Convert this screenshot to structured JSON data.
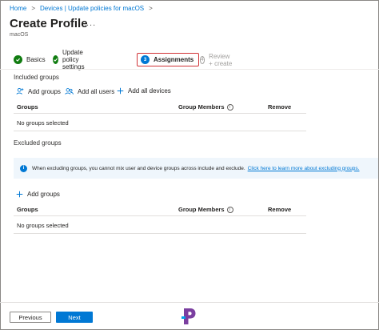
{
  "breadcrumb": {
    "home": "Home",
    "separator": ">",
    "devices": "Devices | Update policies for macOS"
  },
  "header": {
    "title": "Create Profile",
    "subtitle": "macOS",
    "more": "..."
  },
  "steps": [
    {
      "label": "Basics",
      "state": "done",
      "icon": "check-icon"
    },
    {
      "label": "Update policy settings",
      "state": "done",
      "icon": "check-icon"
    },
    {
      "label": "Assignments",
      "number": "3",
      "state": "current"
    },
    {
      "label": "Review + create",
      "number": "4",
      "state": "future"
    }
  ],
  "included": {
    "title": "Included groups",
    "commands": {
      "add_groups": "Add groups",
      "add_all_users": "Add all users",
      "add_all_devices": "Add all devices"
    },
    "table": {
      "columns": [
        "Groups",
        "Group Members",
        "Remove"
      ],
      "empty": "No groups selected"
    }
  },
  "excluded": {
    "title": "Excluded groups",
    "banner": {
      "text": "When excluding groups, you cannot mix user and device groups across include and exclude.",
      "link": "Click here to learn more about excluding groups."
    },
    "commands": {
      "add_groups": "Add groups"
    },
    "table": {
      "columns": [
        "Groups",
        "Group Members",
        "Remove"
      ],
      "empty": "No groups selected"
    }
  },
  "footer": {
    "previous": "Previous",
    "next": "Next"
  },
  "colors": {
    "accent": "#0078d4",
    "success": "#107c10",
    "highlight": "#d13438",
    "logo": "#7b3fa0"
  }
}
